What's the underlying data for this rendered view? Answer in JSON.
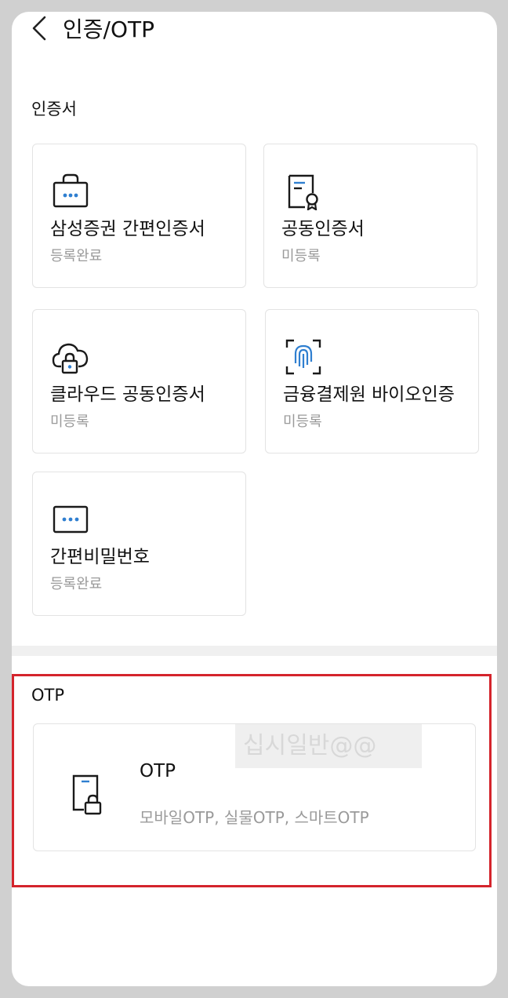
{
  "header": {
    "title": "인증/OTP"
  },
  "certificates": {
    "section_title": "인증서",
    "cards": [
      {
        "title": "삼성증권 간편인증서",
        "status": "등록완료",
        "icon": "bag-dots-icon"
      },
      {
        "title": "공동인증서",
        "status": "미등록",
        "icon": "certificate-document-icon"
      },
      {
        "title": "클라우드 공동인증서",
        "status": "미등록",
        "icon": "cloud-lock-icon"
      },
      {
        "title": "금융결제원 바이오인증",
        "status": "미등록",
        "icon": "fingerprint-scan-icon"
      },
      {
        "title": "간편비밀번호",
        "status": "등록완료",
        "icon": "password-box-icon"
      }
    ]
  },
  "otp": {
    "section_title": "OTP",
    "card": {
      "title": "OTP",
      "description": "모바일OTP, 실물OTP, 스마트OTP",
      "icon": "otp-device-lock-icon"
    }
  },
  "watermark": "십시일반@@",
  "colors": {
    "accent": "#2f7fd0",
    "highlight": "#d4242c",
    "icon_dark": "#1a1a1a"
  }
}
